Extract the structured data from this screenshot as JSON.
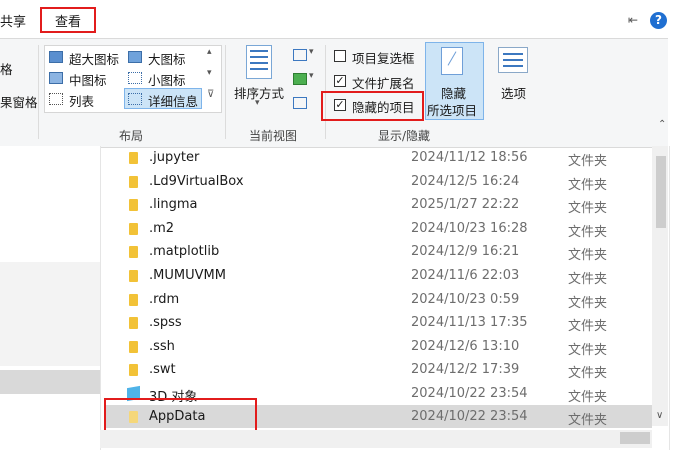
{
  "tabs": {
    "share": "共享",
    "view": "查看"
  },
  "ribbon": {
    "layout": {
      "items": [
        "超大图标",
        "大图标",
        "中图标",
        "小图标",
        "列表",
        "详细信息"
      ],
      "label": "布局"
    },
    "current_view": {
      "sort_label": "排序方式",
      "label": "当前视图"
    },
    "show_hide": {
      "item_checkboxes": "项目复选框",
      "file_extensions": "文件扩展名",
      "hidden_items": "隐藏的项目",
      "hide_selected_line1": "隐藏",
      "hide_selected_line2": "所选项目",
      "options": "选项",
      "label": "显示/隐藏"
    }
  },
  "nav": {
    "partial_1": "格",
    "partial_2": "果窗格"
  },
  "files": [
    {
      "name": ".jupyter",
      "date": "2024/11/12 18:56",
      "type": "文件夹"
    },
    {
      "name": ".Ld9VirtualBox",
      "date": "2024/12/5 16:24",
      "type": "文件夹"
    },
    {
      "name": ".lingma",
      "date": "2025/1/27 22:22",
      "type": "文件夹"
    },
    {
      "name": ".m2",
      "date": "2024/10/23 16:28",
      "type": "文件夹"
    },
    {
      "name": ".matplotlib",
      "date": "2024/12/9 16:21",
      "type": "文件夹"
    },
    {
      "name": ".MUMUVMM",
      "date": "2024/11/6 22:03",
      "type": "文件夹"
    },
    {
      "name": ".rdm",
      "date": "2024/10/23 0:59",
      "type": "文件夹"
    },
    {
      "name": ".spss",
      "date": "2024/11/13 17:35",
      "type": "文件夹"
    },
    {
      "name": ".ssh",
      "date": "2024/12/6 13:10",
      "type": "文件夹"
    },
    {
      "name": ".swt",
      "date": "2024/12/2 17:39",
      "type": "文件夹"
    },
    {
      "name": "3D 对象",
      "date": "2024/10/22 23:54",
      "type": "文件夹"
    },
    {
      "name": "AppData",
      "date": "2024/10/22 23:54",
      "type": "文件夹"
    }
  ],
  "colors": {
    "highlight_red": "#e21c1c",
    "selected_row": "#d9d9d9",
    "folder": "#f2c237"
  }
}
